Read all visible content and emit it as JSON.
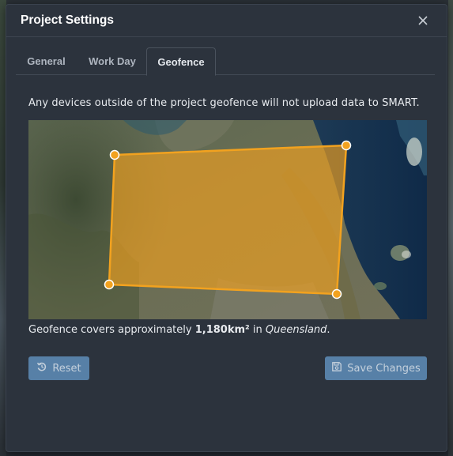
{
  "dialog": {
    "title": "Project Settings",
    "close_icon": "close-icon"
  },
  "tabs": [
    {
      "label": "General",
      "active": false
    },
    {
      "label": "Work Day",
      "active": false
    },
    {
      "label": "Geofence",
      "active": true
    }
  ],
  "geofence": {
    "description": "Any devices outside of the project geofence will not upload data to SMART.",
    "coverage_prefix": "Geofence covers approximately ",
    "coverage_area": "1,180km²",
    "coverage_in": " in ",
    "coverage_region": "Queensland",
    "coverage_suffix": ".",
    "polygon_color": "#f2a21f",
    "vertex_count": 4
  },
  "buttons": {
    "reset_label": "Reset",
    "reset_icon": "undo-icon",
    "save_label": "Save Changes",
    "save_icon": "floppy-disk-icon"
  },
  "colors": {
    "modal_bg": "#2c333d",
    "button_bg": "#5a85ad",
    "accent_polygon": "#f2a21f"
  }
}
